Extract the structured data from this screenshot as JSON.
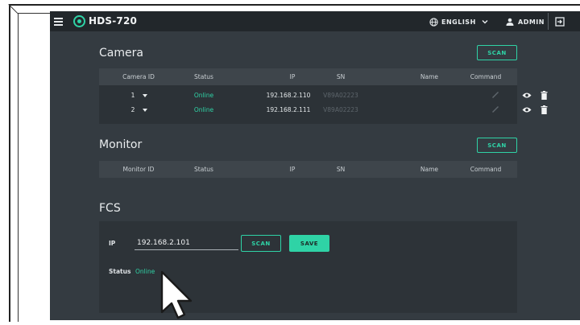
{
  "app": {
    "title": "HDS-720",
    "accent": "#2fd3a6",
    "background": "#343b41",
    "topbar": "#22272b"
  },
  "header": {
    "language": "ENGLISH",
    "user": "ADMIN",
    "icons": [
      "menu-icon",
      "logo-icon",
      "globe-icon",
      "chevron-down-icon",
      "user-icon",
      "logout-icon"
    ]
  },
  "camera": {
    "title": "Camera",
    "scan_label": "SCAN",
    "columns": [
      "Camera ID",
      "Status",
      "IP",
      "SN",
      "Name",
      "Command"
    ],
    "rows": [
      {
        "id": "1",
        "status": "Online",
        "ip": "192.168.2.110",
        "sn": "V89A02223",
        "name": ""
      },
      {
        "id": "2",
        "status": "Online",
        "ip": "192.168.2.111",
        "sn": "V89A02223",
        "name": ""
      }
    ]
  },
  "monitor": {
    "title": "Monitor",
    "scan_label": "SCAN",
    "columns": [
      "Monitor ID",
      "Status",
      "IP",
      "SN",
      "Name",
      "Command"
    ]
  },
  "fcs": {
    "title": "FCS",
    "ip_label": "IP",
    "ip_value": "192.168.2.101",
    "scan_label": "SCAN",
    "save_label": "SAVE",
    "status_label": "Status",
    "status_value": "Online"
  }
}
